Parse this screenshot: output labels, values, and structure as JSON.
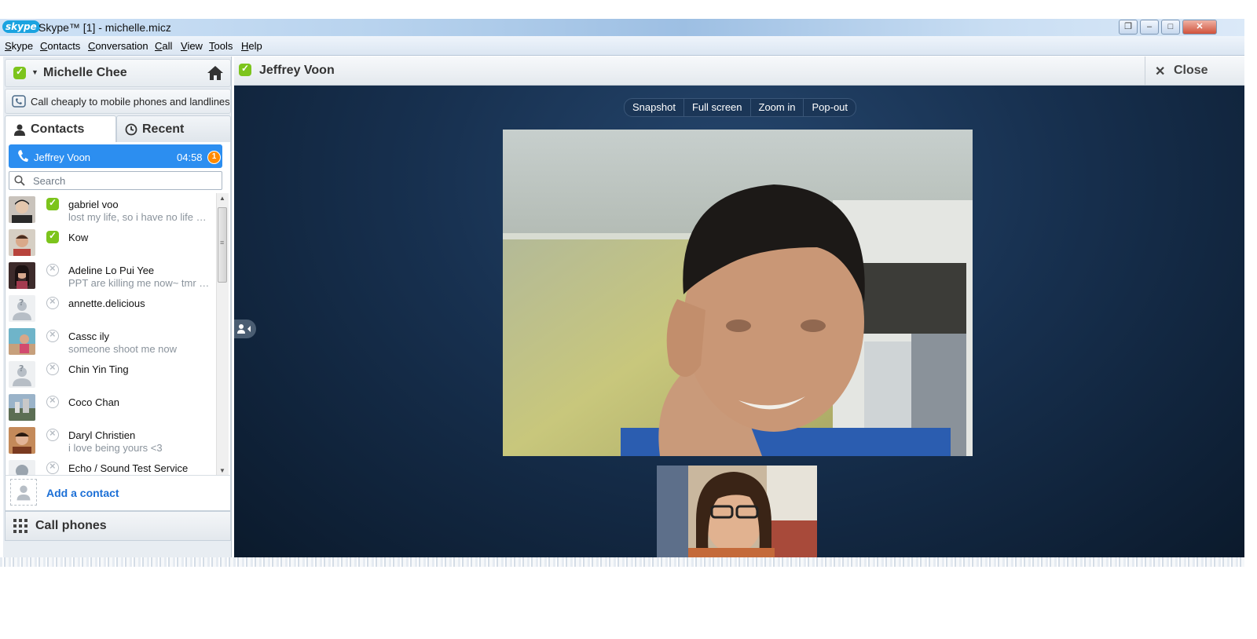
{
  "window": {
    "logo": "skype",
    "title": "Skype™ [1] - michelle.micz",
    "controls": [
      "restore-icon",
      "minimize-icon",
      "maximize-icon",
      "close-icon"
    ]
  },
  "menu": {
    "items": [
      "Skype",
      "Contacts",
      "Conversation",
      "Call",
      "View",
      "Tools",
      "Help"
    ]
  },
  "profile": {
    "name": "Michelle Chee",
    "status": "online",
    "home_icon": "home-icon"
  },
  "promo": {
    "text": "Call cheaply to mobile phones and landlines",
    "icon": "phone-icon"
  },
  "tabs": {
    "contacts": "Contacts",
    "recent": "Recent"
  },
  "active_call": {
    "name": "Jeffrey Voon",
    "time": "04:58",
    "badge": "1"
  },
  "search": {
    "placeholder": "Search"
  },
  "contacts": [
    {
      "name": "gabriel voo",
      "mood": "lost my life, so i have no life now",
      "status": "online"
    },
    {
      "name": "Kow",
      "mood": "",
      "status": "online"
    },
    {
      "name": "Adeline Lo Pui Yee",
      "mood": "PPT are killing me now~ tmr EX...",
      "status": "offline"
    },
    {
      "name": "annette.delicious",
      "mood": "",
      "status": "offline"
    },
    {
      "name": "Cassc ily",
      "mood": "someone shoot me now",
      "status": "offline"
    },
    {
      "name": "Chin Yin Ting",
      "mood": "",
      "status": "offline"
    },
    {
      "name": "Coco Chan",
      "mood": "",
      "status": "offline"
    },
    {
      "name": "Daryl Christien",
      "mood": "i love being yours <3",
      "status": "offline"
    },
    {
      "name": "Echo / Sound Test Service",
      "mood": "",
      "status": "offline"
    }
  ],
  "add_contact": {
    "label": "Add a contact"
  },
  "call_phones": {
    "label": "Call phones"
  },
  "conversation": {
    "name": "Jeffrey Voon",
    "close_label": "Close",
    "video_controls": [
      "Snapshot",
      "Full screen",
      "Zoom in",
      "Pop-out"
    ]
  },
  "colors": {
    "skype_blue": "#1aa3e0",
    "active_call_blue": "#2c8ef0",
    "online_green": "#7cc41c",
    "link_blue": "#1b6fd6",
    "video_bg": "#17304f",
    "badge_orange": "#ff8a00"
  }
}
